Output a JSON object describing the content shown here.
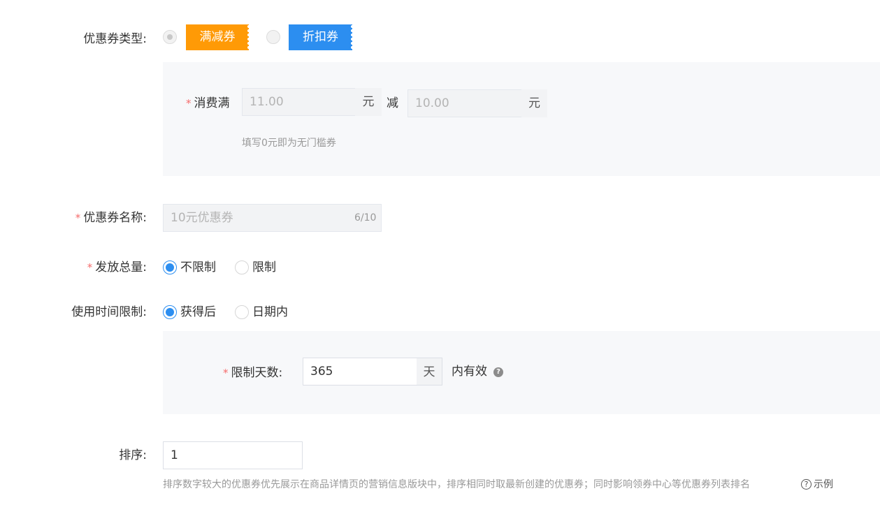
{
  "coupon_type": {
    "label": "优惠券类型:",
    "options": [
      {
        "label": "满减券",
        "color": "#ff9a06"
      },
      {
        "label": "折扣券",
        "color": "#2c8ef0"
      }
    ]
  },
  "threshold": {
    "label": "消费满",
    "spend_value": "11.00",
    "spend_unit": "元",
    "minus_label": "减",
    "discount_value": "10.00",
    "discount_unit": "元",
    "hint": "填写0元即为无门槛券"
  },
  "coupon_name": {
    "label": "优惠券名称:",
    "value": "10元优惠券",
    "counter": "6/10"
  },
  "total_issue": {
    "label": "发放总量:",
    "options": [
      "不限制",
      "限制"
    ]
  },
  "time_limit": {
    "label": "使用时间限制:",
    "options": [
      "获得后",
      "日期内"
    ],
    "days_label": "限制天数:",
    "days_value": "365",
    "days_unit": "天",
    "valid_suffix": "内有效"
  },
  "sort": {
    "label": "排序:",
    "value": "1",
    "hint": "排序数字较大的优惠券优先展示在商品详情页的营销信息版块中，排序相同时取最新创建的优惠券；同时影响领券中心等优惠券列表排名",
    "example_label": "示例"
  },
  "colors": {
    "accent": "#2c8ef0",
    "orange": "#ff9a06",
    "required": "#f56c6c"
  }
}
